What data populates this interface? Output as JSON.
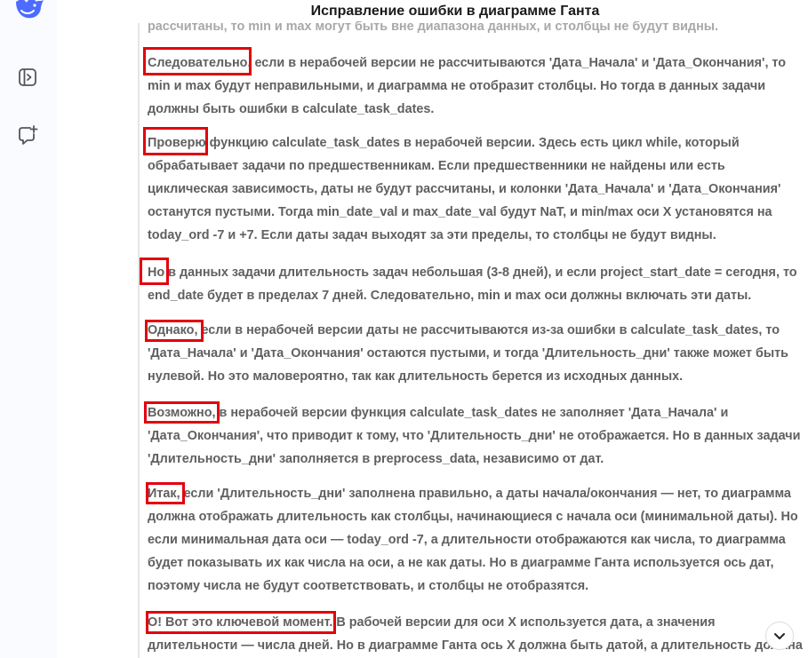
{
  "header": {
    "title": "Исправление ошибки в диаграмме Ганта"
  },
  "sidebar": {
    "icons": [
      "whale-logo-icon",
      "toggle-panel-icon",
      "new-chat-icon"
    ]
  },
  "colors": {
    "accent": "#4d6bfe",
    "highlight": "#e3000f"
  },
  "paragraphs": [
    {
      "text": "рассчитаны, то min и max могут быть вне диапазона данных, и столбцы не будут видны."
    },
    {
      "text": "Следовательно, если в нерабочей версии не рассчитываются 'Дата_Начала' и 'Дата_Окончания', то min и max будут неправильными, и диаграмма не отобразит столбцы. Но тогда в данных задачи должны быть ошибки в calculate_task_dates."
    },
    {
      "text": "Проверю функцию calculate_task_dates в нерабочей версии. Здесь есть цикл while, который обрабатывает задачи по предшественникам. Если предшественники не найдены или есть циклическая зависимость, даты не будут рассчитаны, и колонки 'Дата_Начала' и 'Дата_Окончания' останутся пустыми. Тогда min_date_val и max_date_val будут NaT, и min/max оси X установятся на today_ord -7 и +7. Если даты задач выходят за эти пределы, то столбцы не будут видны."
    },
    {
      "text": "Но в данных задачи длительность задач небольшая (3-8 дней), и если project_start_date = сегодня, то end_date будет в пределах 7 дней. Следовательно, min и max оси должны включать эти даты."
    },
    {
      "text": "Однако, если в нерабочей версии даты не рассчитываются из-за ошибки в calculate_task_dates, то 'Дата_Начала' и 'Дата_Окончания' остаются пустыми, и тогда 'Длительность_дни' также может быть нулевой. Но это маловероятно, так как длительность берется из исходных данных."
    },
    {
      "text": "Возможно, в нерабочей версии функция calculate_task_dates не заполняет 'Дата_Начала' и 'Дата_Окончания', что приводит к тому, что 'Длительность_дни' не отображается. Но в данных задачи 'Длительность_дни' заполняется в preprocess_data, независимо от дат."
    },
    {
      "text": "Итак, если 'Длительность_дни' заполнена правильно, а даты начала/окончания — нет, то диаграмма должна отображать длительность как столбцы, начинающиеся с начала оси (минимальной даты). Но если минимальная дата оси — today_ord -7, а длительности отображаются как числа, то диаграмма будет показывать их как числа на оси, а не как даты. Но в диаграмме Ганта используется ось дат, поэтому числа не будут соответствовать, и столбцы не отобразятся."
    },
    {
      "text": "О! Вот это ключевой момент. В рабочей версии для оси X используется дата, а значения длительности — числа дней. Но в диаграмме Ганта ось X должна быть датой, а длительность должна быть"
    }
  ]
}
